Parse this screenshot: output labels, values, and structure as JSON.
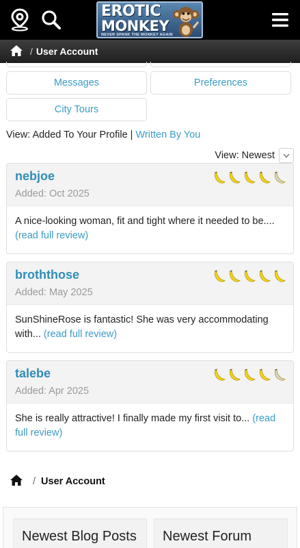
{
  "header": {
    "logo_line1": "EROTIC",
    "logo_line2": "MONKEY",
    "logo_tagline": "NEVER SPANK THE MONKEY AGAIN"
  },
  "icons": {
    "location": "location-pin-icon",
    "search": "search-icon",
    "menu": "hamburger-menu-icon",
    "home": "home-icon",
    "chevron": "chevron-down-icon",
    "banana": "banana-rating-icon"
  },
  "colors": {
    "link": "#3a9bc4",
    "username": "#2f8db8",
    "banana_filled": "#f2d31b",
    "banana_empty": "#d4d4d4"
  },
  "breadcrumb": {
    "separator": "/",
    "current": "User Account"
  },
  "account_buttons": {
    "messages": "Messages",
    "preferences": "Preferences",
    "city_tours": "City Tours"
  },
  "view_filter": {
    "prefix": "View:",
    "active": "Added To Your Profile",
    "divider": "|",
    "other": "Written By You"
  },
  "sort": {
    "label": "View: Newest"
  },
  "reviews": [
    {
      "username": "nebjoe",
      "added": "Added: Oct 2025",
      "rating": 4,
      "text": "A nice-looking woman, fit and tight where it needed to be....",
      "more": "(read full review)"
    },
    {
      "username": "broththose",
      "added": "Added: May 2025",
      "rating": 5,
      "text": "SunShineRose is fantastic! She was very accommodating with...",
      "more": "(read full review)"
    },
    {
      "username": "talebe",
      "added": "Added: Apr 2025",
      "rating": 4,
      "text": "She is really attractive! I finally made my first visit to...",
      "more": "(read full review)"
    }
  ],
  "footer_breadcrumb": {
    "separator": "/",
    "current": "User Account"
  },
  "footer_panels": {
    "blog": "Newest Blog Posts",
    "forum": "Newest Forum"
  }
}
